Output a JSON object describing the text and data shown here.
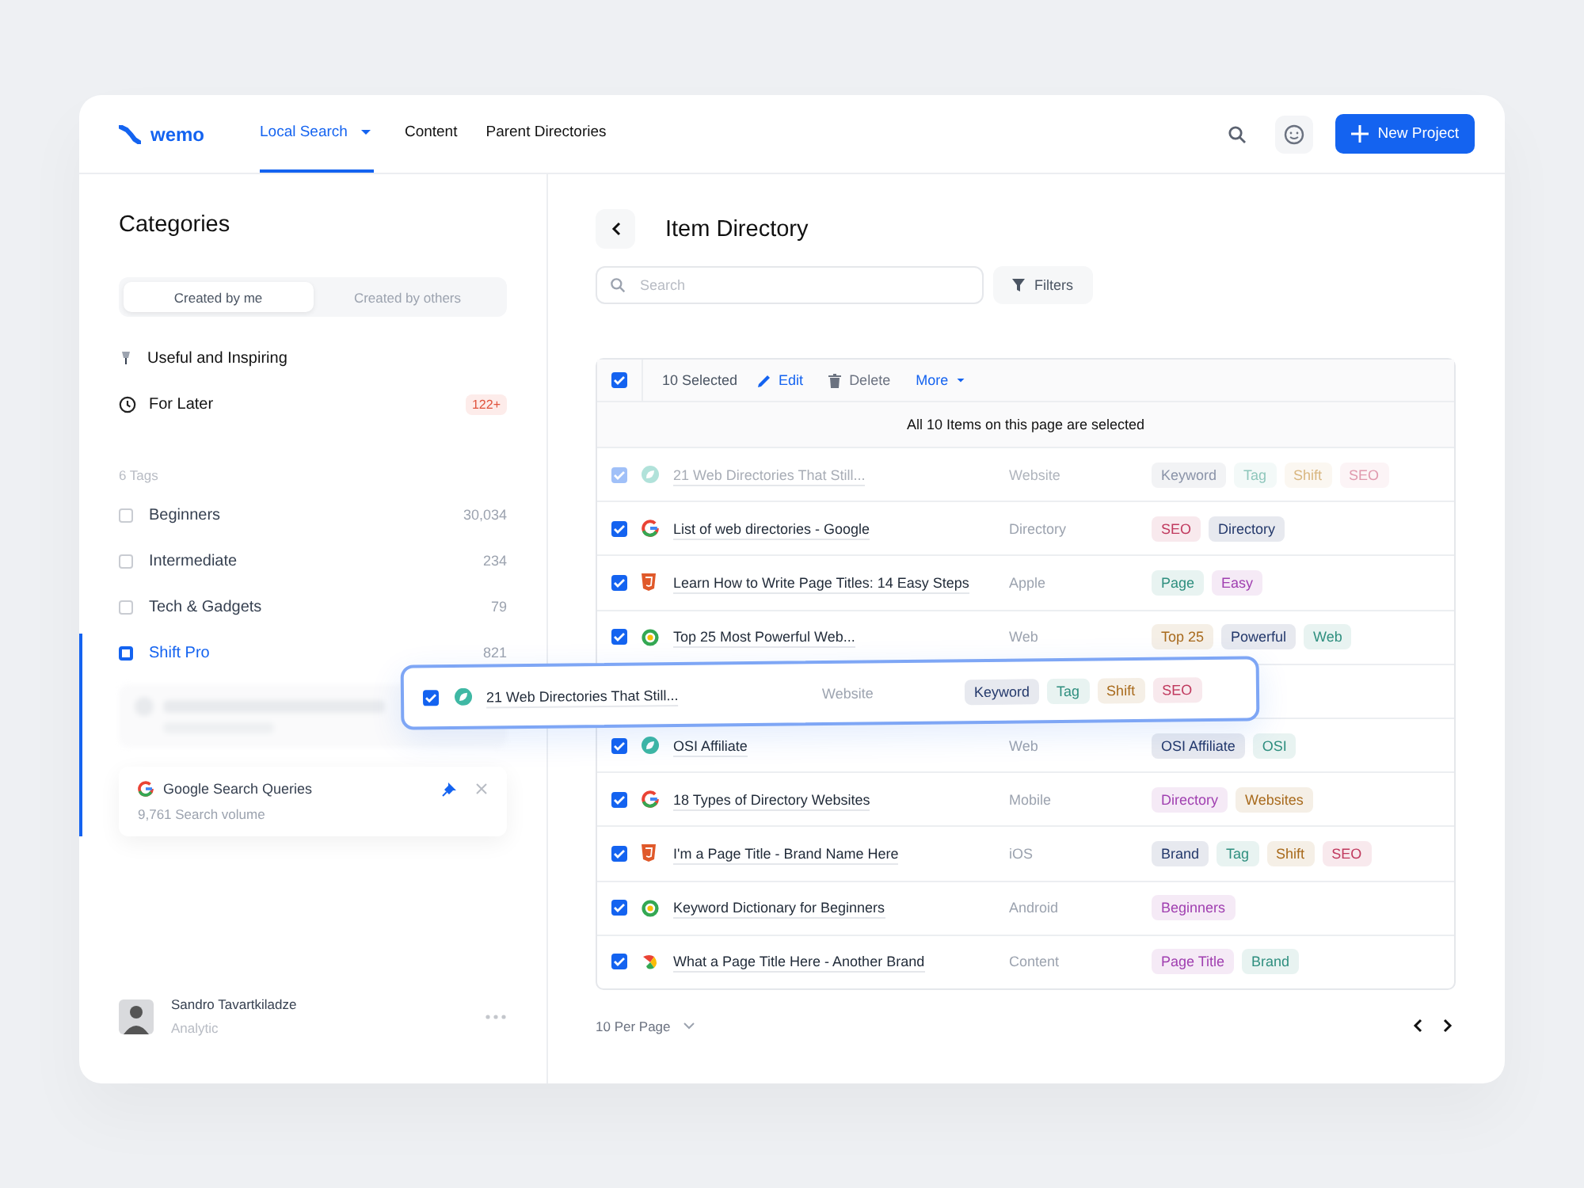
{
  "brand": {
    "name": "wemo"
  },
  "nav": [
    {
      "label": "Local Search",
      "selected": true,
      "dropdown": true
    },
    {
      "label": "Content",
      "selected": false,
      "dropdown": false
    },
    {
      "label": "Parent Directories",
      "selected": false,
      "dropdown": false
    }
  ],
  "new_project_button": "New Project",
  "sidebar": {
    "title": "Categories",
    "segments": [
      {
        "label": "Created by me",
        "selected": true
      },
      {
        "label": "Created by others",
        "selected": false
      }
    ],
    "collections": [
      {
        "label": "Useful and Inspiring",
        "kind": "pin"
      },
      {
        "label": "For Later",
        "kind": "clock",
        "badge": "122+"
      }
    ],
    "tags_heading": "6 Tags",
    "tags": [
      {
        "label": "Beginners",
        "count": "30,034",
        "selected": false
      },
      {
        "label": "Intermediate",
        "count": "234",
        "selected": false
      },
      {
        "label": "Tech & Gadgets",
        "count": "79",
        "selected": false
      },
      {
        "label": "Shift Pro",
        "count": "821",
        "selected": true
      }
    ],
    "query_card": {
      "title": "Google Search Queries",
      "subtitle": "9,761 Search volume"
    },
    "user": {
      "name": "Sandro Tavartkiladze",
      "role": "Analytic"
    }
  },
  "main": {
    "title": "Item Directory",
    "search": {
      "placeholder": "Search"
    },
    "filters_button": "Filters",
    "toolbar": {
      "checked": true,
      "selected_count": "10 Selected",
      "actions": [
        {
          "label": "Edit",
          "kind": "edit"
        },
        {
          "label": "Delete",
          "kind": "delete"
        },
        {
          "label": "More",
          "kind": "more"
        }
      ]
    },
    "banner": "All 10 Items on this page are selected",
    "rows": [
      {
        "kind": "leaf",
        "faded": true,
        "checked": true,
        "title": "21 Web Directories That Still...",
        "type": "Website",
        "tags": [
          {
            "label": "Keyword",
            "color": "#8a93a8"
          },
          {
            "label": "Tag",
            "color": "#8fc7bc"
          },
          {
            "label": "Shift",
            "color": "#d9b781"
          },
          {
            "label": "SEO",
            "color": "#e09aae"
          }
        ]
      },
      {
        "kind": "google",
        "faded": false,
        "checked": true,
        "title": "List of web directories - Google",
        "type": "Directory",
        "tags": [
          {
            "label": "SEO",
            "color": "#c0395e"
          },
          {
            "label": "Directory",
            "color": "#23386b"
          }
        ]
      },
      {
        "kind": "html",
        "faded": false,
        "checked": true,
        "title": "Learn How to Write Page Titles: 14 Easy Steps",
        "type": "Apple",
        "tags": [
          {
            "label": "Page",
            "color": "#2f8f7f"
          },
          {
            "label": "Easy",
            "color": "#a03fb0"
          }
        ]
      },
      {
        "kind": "ring",
        "faded": false,
        "checked": true,
        "title": "Top 25 Most Powerful Web...",
        "type": "Web",
        "tags": [
          {
            "label": "Top 25",
            "color": "#a86a1c"
          },
          {
            "label": "Powerful",
            "color": "#23386b"
          },
          {
            "label": "Web",
            "color": "#2f8f7f"
          }
        ]
      },
      {
        "kind": "drop_slot"
      },
      {
        "kind": "leaf",
        "faded": false,
        "checked": true,
        "title": "OSI Affiliate",
        "type": "Web",
        "tags": [
          {
            "label": "OSI Affiliate",
            "color": "#23386b"
          },
          {
            "label": "OSI",
            "color": "#2f8f7f"
          }
        ]
      },
      {
        "kind": "google",
        "faded": false,
        "checked": true,
        "title": "18 Types of Directory Websites",
        "type": "Mobile",
        "tags": [
          {
            "label": "Directory",
            "color": "#a03fb0"
          },
          {
            "label": "Websites",
            "color": "#a86a1c"
          }
        ]
      },
      {
        "kind": "html",
        "faded": false,
        "checked": true,
        "title": "I'm a Page Title - Brand Name Here",
        "type": "iOS",
        "tags": [
          {
            "label": "Brand",
            "color": "#23386b"
          },
          {
            "label": "Tag",
            "color": "#2f8f7f"
          },
          {
            "label": "Shift",
            "color": "#a86a1c"
          },
          {
            "label": "SEO",
            "color": "#c0395e"
          }
        ]
      },
      {
        "kind": "ring",
        "faded": false,
        "checked": true,
        "title": "Keyword Dictionary for Beginners",
        "type": "Android",
        "tags": [
          {
            "label": "Beginners",
            "color": "#a03fb0"
          }
        ]
      },
      {
        "kind": "pinwheel",
        "faded": false,
        "checked": true,
        "title": "What a Page Title Here - Another Brand",
        "type": "Content",
        "tags": [
          {
            "label": "Page Title",
            "color": "#a03fb0"
          },
          {
            "label": "Brand",
            "color": "#2f8f7f"
          }
        ]
      }
    ],
    "dragged_row": {
      "kind": "leaf",
      "checked": true,
      "title": "21 Web Directories That Still...",
      "type": "Website",
      "tags": [
        {
          "label": "Keyword",
          "color": "#23386b"
        },
        {
          "label": "Tag",
          "color": "#2f8f7f"
        },
        {
          "label": "Shift",
          "color": "#a86a1c"
        },
        {
          "label": "SEO",
          "color": "#c0395e"
        }
      ]
    },
    "per_page": "10 Per Page"
  }
}
